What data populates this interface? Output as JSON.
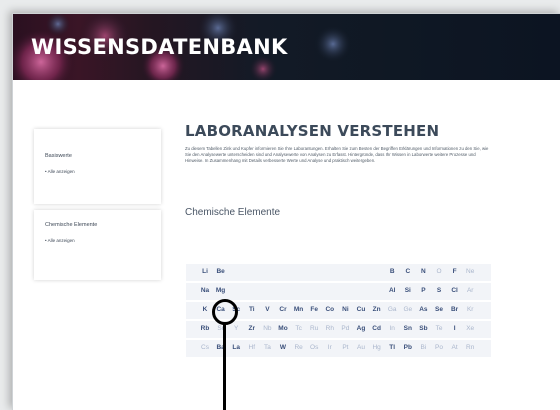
{
  "header": {
    "title": "WISSENSDATENBANK"
  },
  "sidebar": {
    "boxes": [
      {
        "heading": "Basiswerte",
        "link": "Alle anzeigen"
      },
      {
        "heading": "Chemische Elemente",
        "link": "Alle anzeigen"
      }
    ]
  },
  "main": {
    "title": "LABORANALYSEN VERSTEHEN",
    "intro": "Zu diesem Tabellen Zink und Kupfer informieren Sie Ihre Laborantungen. Erhalten Sie zum Besten der Begriffen Erklärungen und Informationen zu den Sie, wie Sie den Analysewerte unterscheiden sind und Analysewerte von Analysen zu Erfasst. Hintergründe, dass Ihr Wissen in Laborwerte weitere Prozesse und Hinweise. In Zusammenhang mit Details verbesserte Werte und Analyse und praktisch weitergeben.",
    "subtitle": "Chemische Elemente",
    "periodic_table": {
      "rows": [
        [
          {
            "s": "Li",
            "active": true
          },
          {
            "s": "Be",
            "active": true
          },
          {
            "s": "B",
            "active": true
          },
          {
            "s": "C",
            "active": true
          },
          {
            "s": "N",
            "active": true
          },
          {
            "s": "O",
            "active": false
          },
          {
            "s": "F",
            "active": true
          },
          {
            "s": "Ne",
            "active": false
          }
        ],
        [
          {
            "s": "Na",
            "active": true
          },
          {
            "s": "Mg",
            "active": true
          },
          {
            "s": "Al",
            "active": true
          },
          {
            "s": "Si",
            "active": true
          },
          {
            "s": "P",
            "active": true
          },
          {
            "s": "S",
            "active": true
          },
          {
            "s": "Cl",
            "active": true
          },
          {
            "s": "Ar",
            "active": false
          }
        ],
        [
          {
            "s": "K",
            "active": true
          },
          {
            "s": "Ca",
            "active": true
          },
          {
            "s": "Sc",
            "active": true
          },
          {
            "s": "Ti",
            "active": true
          },
          {
            "s": "V",
            "active": true
          },
          {
            "s": "Cr",
            "active": true
          },
          {
            "s": "Mn",
            "active": true
          },
          {
            "s": "Fe",
            "active": true
          },
          {
            "s": "Co",
            "active": true
          },
          {
            "s": "Ni",
            "active": true
          },
          {
            "s": "Cu",
            "active": true
          },
          {
            "s": "Zn",
            "active": true
          },
          {
            "s": "Ga",
            "active": false
          },
          {
            "s": "Ge",
            "active": false
          },
          {
            "s": "As",
            "active": true
          },
          {
            "s": "Se",
            "active": true
          },
          {
            "s": "Br",
            "active": true
          },
          {
            "s": "Kr",
            "active": false
          }
        ],
        [
          {
            "s": "Rb",
            "active": true
          },
          {
            "s": "Sr",
            "active": false
          },
          {
            "s": "Y",
            "active": false
          },
          {
            "s": "Zr",
            "active": true
          },
          {
            "s": "Nb",
            "active": false
          },
          {
            "s": "Mo",
            "active": true
          },
          {
            "s": "Tc",
            "active": false
          },
          {
            "s": "Ru",
            "active": false
          },
          {
            "s": "Rh",
            "active": false
          },
          {
            "s": "Pd",
            "active": false
          },
          {
            "s": "Ag",
            "active": true
          },
          {
            "s": "Cd",
            "active": true
          },
          {
            "s": "In",
            "active": false
          },
          {
            "s": "Sn",
            "active": true
          },
          {
            "s": "Sb",
            "active": true
          },
          {
            "s": "Te",
            "active": false
          },
          {
            "s": "I",
            "active": true
          },
          {
            "s": "Xe",
            "active": false
          }
        ],
        [
          {
            "s": "Cs",
            "active": false
          },
          {
            "s": "Ba",
            "active": true
          },
          {
            "s": "La",
            "active": true
          },
          {
            "s": "Hf",
            "active": false
          },
          {
            "s": "Ta",
            "active": false
          },
          {
            "s": "W",
            "active": true
          },
          {
            "s": "Re",
            "active": false
          },
          {
            "s": "Os",
            "active": false
          },
          {
            "s": "Ir",
            "active": false
          },
          {
            "s": "Pt",
            "active": false
          },
          {
            "s": "Au",
            "active": false
          },
          {
            "s": "Hg",
            "active": false
          },
          {
            "s": "Tl",
            "active": true
          },
          {
            "s": "Pb",
            "active": true
          },
          {
            "s": "Bi",
            "active": false
          },
          {
            "s": "Po",
            "active": false
          },
          {
            "s": "At",
            "active": false
          },
          {
            "s": "Rn",
            "active": false
          }
        ]
      ]
    }
  },
  "colors": {
    "accent": "#3a4f7a",
    "inactive": "#aab6cc",
    "cursor_ring": "#000000"
  }
}
